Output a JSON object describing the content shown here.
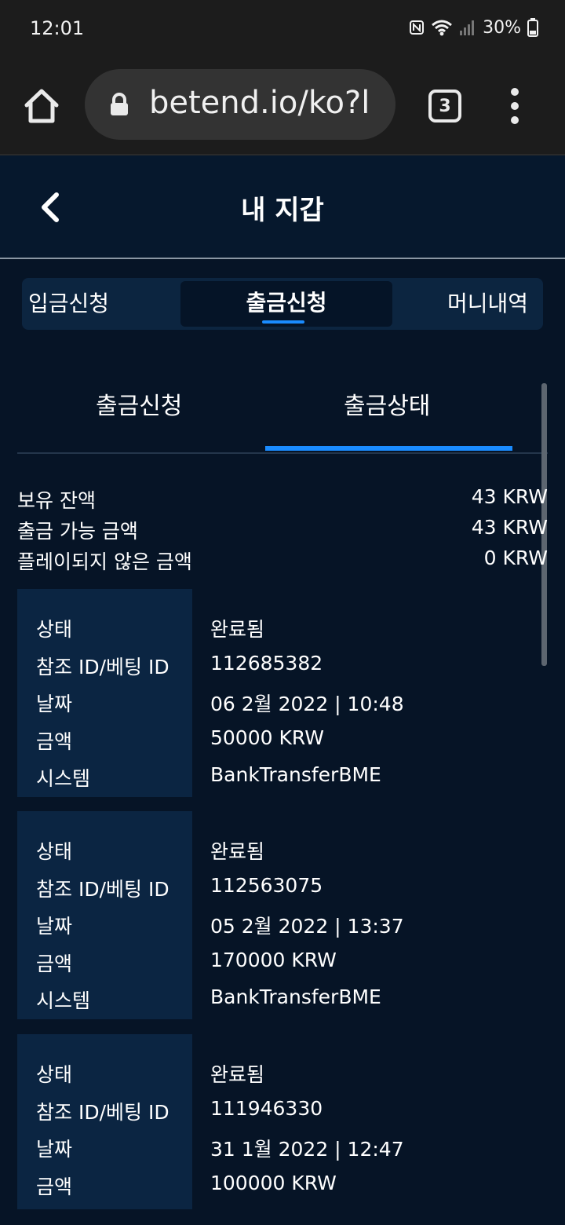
{
  "status_bar": {
    "time": "12:01",
    "battery": "30%"
  },
  "browser": {
    "url": "betend.io/ko?l",
    "tab_count": "3"
  },
  "header": {
    "title": "내 지갑"
  },
  "segments": [
    "입금신청",
    "출금신청",
    "머니내역"
  ],
  "subtabs": [
    "출금신청",
    "출금상태"
  ],
  "balance": [
    {
      "label": "보유 잔액",
      "value": "43 KRW"
    },
    {
      "label": "출금 가능 금액",
      "value": "43 KRW"
    },
    {
      "label": "플레이되지 않은 금액",
      "value": "0 KRW"
    }
  ],
  "field_labels": {
    "status": "상태",
    "ref": "참조 ID/베팅 ID",
    "date": "날짜",
    "amount": "금액",
    "system": "시스템"
  },
  "transactions": [
    {
      "status": "완료됨",
      "ref": "112685382",
      "date": "06 2월 2022 | 10:48",
      "amount": "50000 KRW",
      "system": "BankTransferBME"
    },
    {
      "status": "완료됨",
      "ref": "112563075",
      "date": "05 2월 2022 | 13:37",
      "amount": "170000 KRW",
      "system": "BankTransferBME"
    },
    {
      "status": "완료됨",
      "ref": "111946330",
      "date": "31 1월 2022 | 12:47",
      "amount": "100000 KRW"
    }
  ],
  "colors": {
    "accent": "#1a8cff",
    "background": "#061426",
    "label_panel": "#0b2542"
  }
}
